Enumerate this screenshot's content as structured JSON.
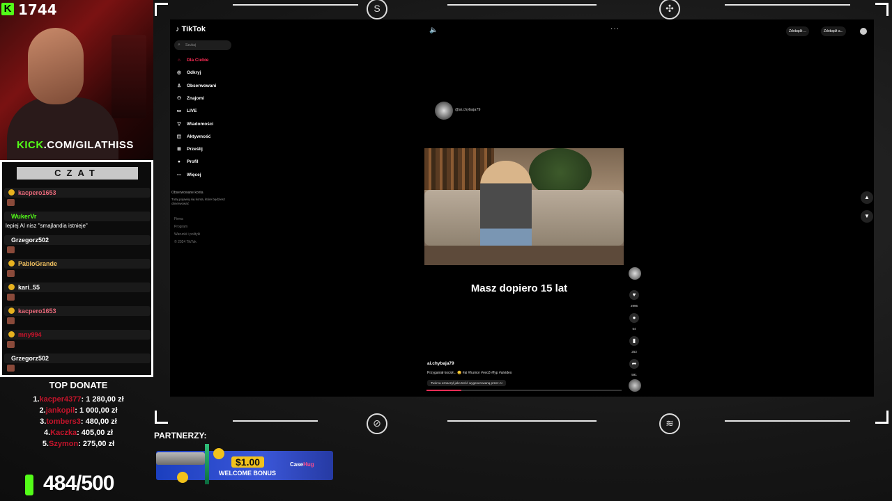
{
  "stream": {
    "viewer_count": "1744",
    "kick_url_prefix": "KICK",
    "kick_url_rest": ".COM/GILATHISS",
    "chat_title": "CZAT",
    "chat": [
      {
        "name": "kacpero1653",
        "color": "#e8697a",
        "message": ""
      },
      {
        "name": "WukerVr",
        "color": "#53fc18",
        "message": "lepiej AI nisz \"smajlandia istnieje\""
      },
      {
        "name": "Grzegorz502",
        "color": "#ffffff",
        "message": ""
      },
      {
        "name": "PabloGrande",
        "color": "#f0c060",
        "message": ""
      },
      {
        "name": "kari_55",
        "color": "#ffffff",
        "message": ""
      },
      {
        "name": "kacpero1653",
        "color": "#e8697a",
        "message": ""
      },
      {
        "name": "mny994",
        "color": "#c4142b",
        "message": ""
      },
      {
        "name": "Grzegorz502",
        "color": "#ffffff",
        "message": ""
      }
    ],
    "top_donate_title": "TOP DONATE",
    "top_donate": [
      {
        "rank": "1.",
        "name": "kacper4377",
        "amount": ": 1 280,00 zł"
      },
      {
        "rank": "2.",
        "name": "jankopil",
        "amount": ": 1 000,00 zł"
      },
      {
        "rank": "3.",
        "name": "tombers3",
        "amount": ": 480,00 zł"
      },
      {
        "rank": "4.",
        "name": "Kaczka",
        "amount": ": 405,00 zł"
      },
      {
        "rank": "5.",
        "name": "Szymon",
        "amount": ": 275,00 zł"
      }
    ],
    "subs_progress": "484/500",
    "partners_label": "PARTNERZY:",
    "sponsor": {
      "price": "$1.00",
      "bonus": "WELCOME BONUS",
      "brand_a": "Case",
      "brand_b": "Hug"
    }
  },
  "tiktok": {
    "logo": "TikTok",
    "search_placeholder": "Szukaj",
    "nav": [
      {
        "icon": "home-icon",
        "glyph": "⌂",
        "label": "Dla Ciebie",
        "active": true
      },
      {
        "icon": "compass-icon",
        "glyph": "◎",
        "label": "Odkryj",
        "active": false
      },
      {
        "icon": "user-follow-icon",
        "glyph": "♙",
        "label": "Obserwowani",
        "active": false
      },
      {
        "icon": "friends-icon",
        "glyph": "⚇",
        "label": "Znajomi",
        "active": false
      },
      {
        "icon": "live-icon",
        "glyph": "▭",
        "label": "LIVE",
        "active": false
      },
      {
        "icon": "messages-icon",
        "glyph": "▽",
        "label": "Wiadomości",
        "active": false
      },
      {
        "icon": "activity-icon",
        "glyph": "◫",
        "label": "Aktywność",
        "active": false
      },
      {
        "icon": "upload-icon",
        "glyph": "⊞",
        "label": "Prześlij",
        "active": false
      },
      {
        "icon": "profile-icon",
        "glyph": "●",
        "label": "Profil",
        "active": false
      },
      {
        "icon": "more-icon",
        "glyph": "⋯",
        "label": "Więcej",
        "active": false
      }
    ],
    "followed_title": "Obserwowane konta",
    "followed_desc": "Tutaj pojawią się konta, które będziesz obserwować",
    "footer": [
      "Firma",
      "Program",
      "Warunki i polityki",
      "© 2024 TikTok"
    ],
    "top_buttons": [
      "Zdobądź ...",
      "Zdobądź a..."
    ],
    "author_handle": "@ai.chybaja79",
    "caption": "Masz dopiero 15 lat",
    "actions": [
      {
        "icon": "heart-icon",
        "glyph": "♥",
        "count": "2996"
      },
      {
        "icon": "comment-icon",
        "glyph": "●",
        "count": "54"
      },
      {
        "icon": "bookmark-icon",
        "glyph": "▮",
        "count": "253"
      },
      {
        "icon": "share-icon",
        "glyph": "➦",
        "count": "591"
      }
    ],
    "bottom_author": "ai.chybaja79",
    "bottom_desc": "Przyganiał kocioł... 😊 #ai #humor #veo3 #fyp #aivideo",
    "ai_label": "Twórca oznaczył jako treść wygenerowaną przez AI",
    "playback_progress": 0.18,
    "accent": "#fe2c55"
  }
}
